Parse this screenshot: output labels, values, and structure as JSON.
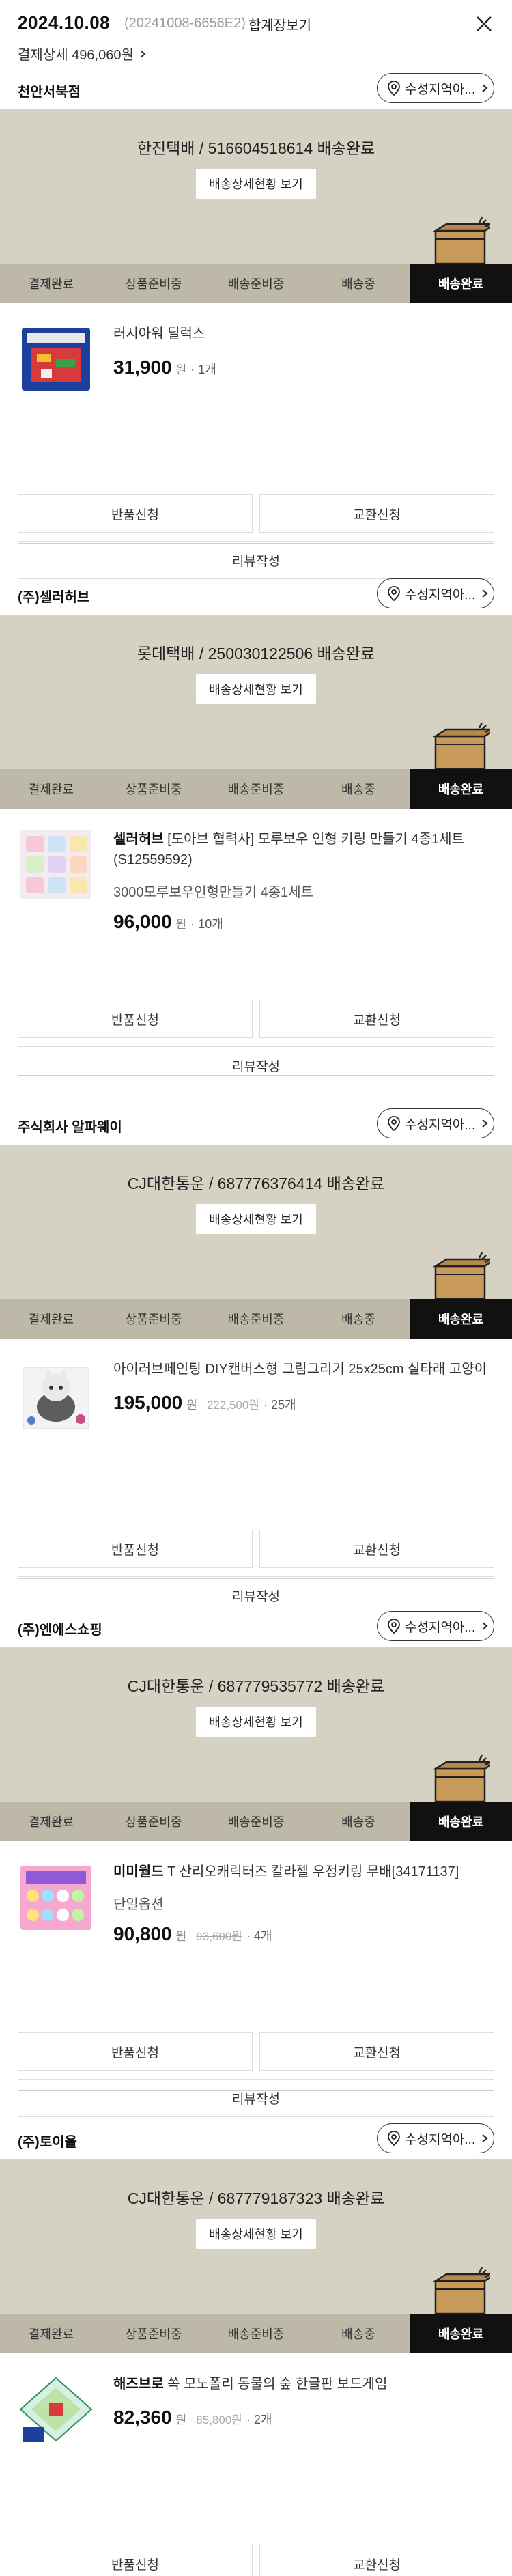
{
  "header": {
    "date": "2024.10.08",
    "order_no": "(20241008-6656E2)",
    "merge_label": "합계장보기",
    "payment_label": "결제상세 496,060원",
    "close_icon": "close-icon"
  },
  "common": {
    "region_button": "수성지역아...",
    "tracking_button": "배송상세현황 보기",
    "steps": [
      "결제완료",
      "상품준비중",
      "배송준비중",
      "배송중",
      "배송완료"
    ],
    "active_step": 4,
    "return_button": "반품신청",
    "exchange_button": "교환신청",
    "review_button": "리뷰작성",
    "won_unit": "원"
  },
  "orders": [
    {
      "seller": "천안서북점",
      "shipping": "한진택배 / 516604518614 배송완료",
      "brand": "",
      "product_name": "러시아워 딜럭스",
      "option": "",
      "price": "31,900",
      "original_price": "",
      "quantity": "· 1개",
      "thumb_icon": "board-game-icon"
    },
    {
      "seller": "(주)셀러허브",
      "shipping": "롯데택배 / 250030122506 배송완료",
      "brand": "셀러허브",
      "product_name": "[도아브 협력사] 모루보우 인형 키링 만들기 4종1세트 (S12559592)",
      "option": "3000모루보우인형만들기 4종1세트",
      "price": "96,000",
      "original_price": "",
      "quantity": "· 10개",
      "thumb_icon": "craft-kit-icon"
    },
    {
      "seller": "주식회사 알파웨이",
      "shipping": "CJ대한통운 / 687776376414 배송완료",
      "brand": "",
      "product_name": "아이러브페인팅 DIY캔버스형 그림그리기 25x25cm 실타래 고양이",
      "option": "",
      "price": "195,000",
      "original_price": "222,500원",
      "quantity": "· 25개",
      "thumb_icon": "cat-painting-icon"
    },
    {
      "seller": "(주)엔에스쇼핑",
      "shipping": "CJ대한통운 / 687779535772 배송완료",
      "brand": "미미월드",
      "product_name": "T 산리오캐릭터즈 칼라젤 우정키링 무배[34171137]",
      "option": "단일옵션",
      "price": "90,800",
      "original_price": "93,600원",
      "quantity": "· 4개",
      "thumb_icon": "keyring-kit-icon"
    },
    {
      "seller": "(주)토이올",
      "shipping": "CJ대한통운 / 687779187323 배송완료",
      "brand": "해즈브로",
      "product_name": "쏙 모노폴리 동물의 숲 한글판 보드게임",
      "option": "",
      "price": "82,360",
      "original_price": "85,800원",
      "quantity": "· 2개",
      "thumb_icon": "monopoly-board-icon"
    }
  ]
}
